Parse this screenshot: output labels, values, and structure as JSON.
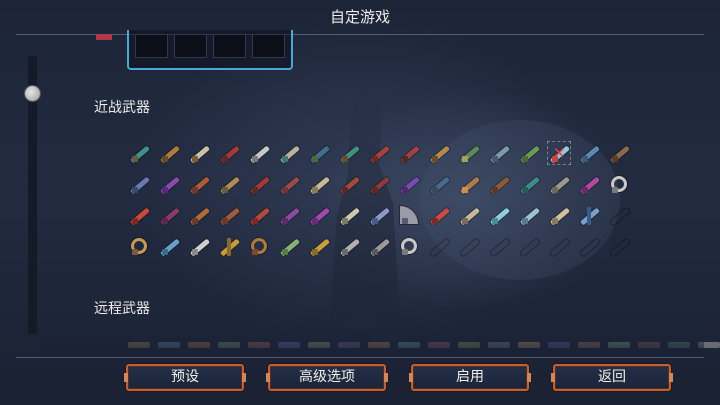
{
  "header": {
    "title": "自定游戏"
  },
  "sections": {
    "melee_title": "近战武器",
    "ranged_title": "远程武器"
  },
  "melee_weapons": {
    "rows": [
      [
        {
          "icon": "scythe-icon",
          "c1": "#3f8f8a",
          "c2": "#6b5a3c"
        },
        {
          "icon": "dagger-icon",
          "c1": "#b07a3a",
          "c2": "#6a4a2c"
        },
        {
          "icon": "sword-icon",
          "c1": "#c9c2a8",
          "c2": "#7a5d38"
        },
        {
          "icon": "whip-icon",
          "c1": "#a23a3a",
          "c2": "#5a2a2a"
        },
        {
          "icon": "twin-daggers-icon",
          "c1": "#c8c8c8",
          "c2": "#7a7a7a"
        },
        {
          "icon": "rapier-icon",
          "c1": "#b7b29a",
          "c2": "#3f7a78"
        },
        {
          "icon": "shovel-icon",
          "c1": "#3f6f8a",
          "c2": "#4e6a3a"
        },
        {
          "icon": "spear-icon",
          "c1": "#3f8f7a",
          "c2": "#6a4a2c"
        },
        {
          "icon": "flail-icon",
          "c1": "#a84040",
          "c2": "#6a2a2a"
        },
        {
          "icon": "hammer-icon",
          "c1": "#a04040",
          "c2": "#4a2a2a"
        },
        {
          "icon": "broadsword-icon",
          "c1": "#b48a4a",
          "c2": "#6a4a2c"
        },
        {
          "icon": "axe-icon",
          "c1": "#5a8a5a",
          "c2": "#a8a060"
        },
        {
          "icon": "halberd-icon",
          "c1": "#7a9aa8",
          "c2": "#4a5a6a"
        },
        {
          "icon": "lance-icon",
          "c1": "#6a9a5a",
          "c2": "#4a6a3a"
        },
        {
          "icon": "frost-blade-icon",
          "c1": "#8fc8e0",
          "c2": "#d04040",
          "selected": true
        },
        {
          "icon": "trident-icon",
          "c1": "#5a8ab0",
          "c2": "#3a5a7a"
        },
        {
          "icon": "claw-icon",
          "c1": "#8a6a4a",
          "c2": "#5a3a2a"
        }
      ],
      [
        {
          "icon": "katana-icon",
          "c1": "#6a7ab0",
          "c2": "#3a4a6a"
        },
        {
          "icon": "shield-icon",
          "c1": "#8a4ab0",
          "c2": "#5a2a7a"
        },
        {
          "icon": "club-icon",
          "c1": "#b05a3a",
          "c2": "#6a3a2a"
        },
        {
          "icon": "boomerang-icon",
          "c1": "#b08a5a",
          "c2": "#6a5a3a"
        },
        {
          "icon": "mace-icon",
          "c1": "#a03a3a",
          "c2": "#5a2a2a"
        },
        {
          "icon": "spiked-club-icon",
          "c1": "#9a4a4a",
          "c2": "#6a3a3a"
        },
        {
          "icon": "bone-icon",
          "c1": "#c8b89a",
          "c2": "#8a7a5a"
        },
        {
          "icon": "gauntlet-icon",
          "c1": "#a04a40",
          "c2": "#5a2a2a"
        },
        {
          "icon": "sickle-icon",
          "c1": "#8a3a3a",
          "c2": "#5a2a2a"
        },
        {
          "icon": "crescent-blade-icon",
          "c1": "#7a4ab0",
          "c2": "#4a2a6a"
        },
        {
          "icon": "pike-icon",
          "c1": "#4a6a8a",
          "c2": "#3a4a5a"
        },
        {
          "icon": "torch-icon",
          "c1": "#b07a4a",
          "c2": "#d09050"
        },
        {
          "icon": "greatsword-icon",
          "c1": "#8a5a3a",
          "c2": "#5a3a2a"
        },
        {
          "icon": "javelin-icon",
          "c1": "#3f8a8a",
          "c2": "#2a5a5a"
        },
        {
          "icon": "crossbow-blade-icon",
          "c1": "#9a9a8a",
          "c2": "#6a6a5a"
        },
        {
          "icon": "hook-icon",
          "c1": "#b04aa0",
          "c2": "#6a2a6a"
        },
        {
          "icon": "frying-pan-icon",
          "c1": "#c8c8c8",
          "c2": "#7a7a7a",
          "shape": "round"
        }
      ],
      [
        {
          "icon": "fire-shield-icon",
          "c1": "#c84a3a",
          "c2": "#7a2a2a"
        },
        {
          "icon": "bat-wing-icon",
          "c1": "#8a3a6a",
          "c2": "#5a2a4a"
        },
        {
          "icon": "lute-icon",
          "c1": "#b06a3a",
          "c2": "#6a3a2a"
        },
        {
          "icon": "cane-icon",
          "c1": "#a05a3a",
          "c2": "#6a3a2a"
        },
        {
          "icon": "meat-club-icon",
          "c1": "#b04a3a",
          "c2": "#7a2a2a"
        },
        {
          "icon": "tentacle-icon",
          "c1": "#8a4aa0",
          "c2": "#5a2a6a"
        },
        {
          "icon": "lantern-icon",
          "c1": "#a04ab0",
          "c2": "#6a2a7a"
        },
        {
          "icon": "thin-sword-icon",
          "c1": "#c8c8b0",
          "c2": "#7a7a6a"
        },
        {
          "icon": "hand-crossbow-icon",
          "c1": "#8a9ac8",
          "c2": "#4a5a8a"
        },
        {
          "icon": "war-fan-icon",
          "c1": "#9a9aa8",
          "c2": "#5a5a6a",
          "shape": "fan"
        },
        {
          "icon": "heart-blade-icon",
          "c1": "#c84a4a",
          "c2": "#7a2a2a"
        },
        {
          "icon": "crossed-swords-icon",
          "c1": "#c8b89a",
          "c2": "#7a6a5a"
        },
        {
          "icon": "ice-sword-icon",
          "c1": "#8ad0e0",
          "c2": "#4a8a9a"
        },
        {
          "icon": "longsword-icon",
          "c1": "#a0c0d0",
          "c2": "#5a7a8a"
        },
        {
          "icon": "tooth-icon",
          "c1": "#d0c0a0",
          "c2": "#8a7a5a"
        },
        {
          "icon": "candelabra-icon",
          "c1": "#7aa0c8",
          "c2": "#3a5a8a",
          "shape": "cross"
        },
        {
          "icon": "empty-slot",
          "c1": "rgba(0,0,0,0)",
          "c2": "rgba(0,0,0,0)"
        }
      ],
      [
        {
          "icon": "chain-hook-icon",
          "c1": "#c89a5a",
          "c2": "#7a5a3a",
          "shape": "round"
        },
        {
          "icon": "ice-axe-icon",
          "c1": "#6aa0c8",
          "c2": "#3a6a8a"
        },
        {
          "icon": "moon-blade-icon",
          "c1": "#d0d0d0",
          "c2": "#8a8a8a"
        },
        {
          "icon": "orb-flail-icon",
          "c1": "#c89a3a",
          "c2": "#8a6a2a",
          "shape": "cross"
        },
        {
          "icon": "morning-star-icon",
          "c1": "#b07a3a",
          "c2": "#7a4a2a",
          "shape": "round"
        },
        {
          "icon": "jade-sword-icon",
          "c1": "#8ab07a",
          "c2": "#5a7a4a"
        },
        {
          "icon": "golden-knuckle-icon",
          "c1": "#c8a03a",
          "c2": "#8a6a2a"
        },
        {
          "icon": "steel-sabre-icon",
          "c1": "#b0b0b0",
          "c2": "#6a6a6a"
        },
        {
          "icon": "anchor-icon",
          "c1": "#9a9a9a",
          "c2": "#5a5a5a"
        },
        {
          "icon": "oven-axe-icon",
          "c1": "#c8c8c8",
          "c2": "#7a7a7a",
          "shape": "round"
        },
        {
          "icon": "empty-slot",
          "c1": "rgba(0,0,0,0)",
          "c2": "rgba(0,0,0,0)"
        },
        {
          "icon": "empty-slot",
          "c1": "rgba(0,0,0,0)",
          "c2": "rgba(0,0,0,0)"
        },
        {
          "icon": "empty-slot",
          "c1": "rgba(0,0,0,0)",
          "c2": "rgba(0,0,0,0)"
        },
        {
          "icon": "empty-slot",
          "c1": "rgba(0,0,0,0)",
          "c2": "rgba(0,0,0,0)"
        },
        {
          "icon": "empty-slot",
          "c1": "rgba(0,0,0,0)",
          "c2": "rgba(0,0,0,0)"
        },
        {
          "icon": "empty-slot",
          "c1": "rgba(0,0,0,0)",
          "c2": "rgba(0,0,0,0)"
        },
        {
          "icon": "empty-slot",
          "c1": "rgba(0,0,0,0)",
          "c2": "rgba(0,0,0,0)"
        }
      ]
    ]
  },
  "ranged_weapons": {
    "colors": [
      "#8a7a5a",
      "#5a7a9a",
      "#9a6a4a",
      "#6a8a6a",
      "#9a5a5a",
      "#5a6a9a",
      "#8a8a6a",
      "#6a5a8a",
      "#9a7a4a",
      "#5a8a8a",
      "#8a5a6a",
      "#7a8a5a",
      "#6a7a8a",
      "#9a8a5a",
      "#5a5a8a",
      "#8a6a5a",
      "#6a9a7a",
      "#7a5a5a",
      "#5a7a6a",
      "#8a8a8a"
    ]
  },
  "buttons": {
    "presets": "预设",
    "advanced": "高级选项",
    "enable": "启用",
    "back": "返回"
  }
}
